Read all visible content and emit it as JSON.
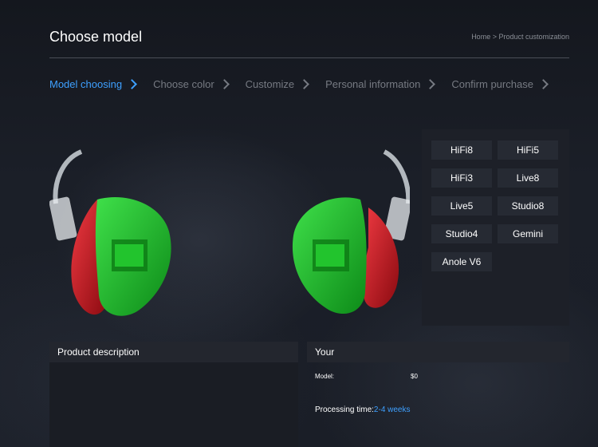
{
  "header": {
    "title": "Choose model",
    "breadcrumb": "Home > Product customization"
  },
  "steps": [
    {
      "label": "Model choosing",
      "active": true
    },
    {
      "label": "Choose color",
      "active": false
    },
    {
      "label": "Customize",
      "active": false
    },
    {
      "label": "Personal information",
      "active": false
    },
    {
      "label": "Confirm purchase",
      "active": false
    }
  ],
  "models": [
    "HiFi8",
    "HiFi5",
    "HiFi3",
    "Live8",
    "Live5",
    "Studio8",
    "Studio4",
    "Gemini",
    "Anole V6"
  ],
  "description": {
    "title": "Product description"
  },
  "your": {
    "title": "Your",
    "model_label": "Model:",
    "price": "$0",
    "processing_label": "Processing time:",
    "processing_value": "2-4 weeks"
  },
  "colors": {
    "accent": "#3ea0ff",
    "earphone_shell": "#1fb82a",
    "earphone_faceplate": "#c4141c"
  }
}
